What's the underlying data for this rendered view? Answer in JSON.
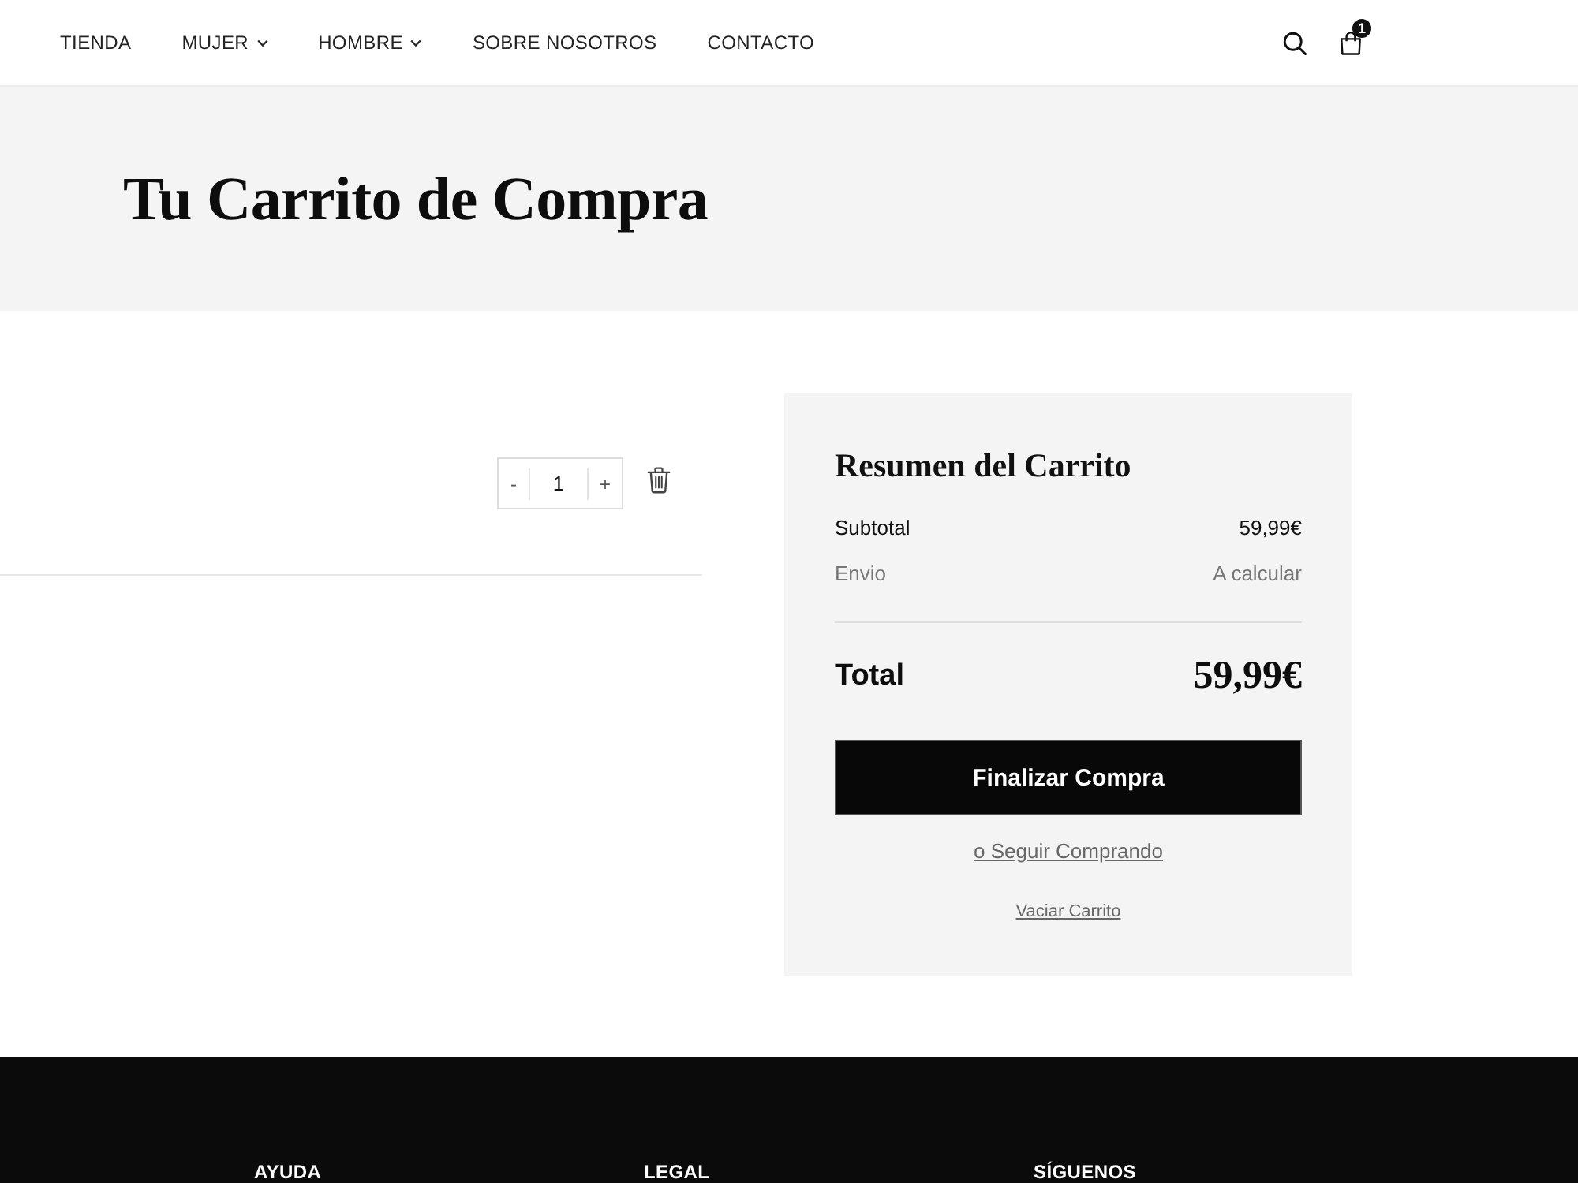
{
  "nav": {
    "links": [
      {
        "label": "TIENDA",
        "dropdown": false
      },
      {
        "label": "MUJER",
        "dropdown": true
      },
      {
        "label": "HOMBRE",
        "dropdown": true
      },
      {
        "label": "SOBRE NOSOTROS",
        "dropdown": false
      },
      {
        "label": "CONTACTO",
        "dropdown": false
      }
    ],
    "cart_count": "1"
  },
  "hero": {
    "title": "Tu Carrito de Compra"
  },
  "cart_item": {
    "decrement": "-",
    "quantity": "1",
    "increment": "+"
  },
  "summary": {
    "title": "Resumen del Carrito",
    "rows": [
      {
        "label": "Subtotal",
        "value": "59,99€",
        "muted": false
      },
      {
        "label": "Envio",
        "value": "A calcular",
        "muted": true
      }
    ],
    "total": {
      "label": "Total",
      "value": "59,99€"
    },
    "checkout_button": "Finalizar Compra",
    "continue_link": "o Seguir Comprando",
    "clear_link": "Vaciar Carrito"
  },
  "footer": {
    "columns": [
      {
        "heading": "AYUDA"
      },
      {
        "heading": "LEGAL"
      },
      {
        "heading": "SÍGUENOS"
      }
    ]
  }
}
